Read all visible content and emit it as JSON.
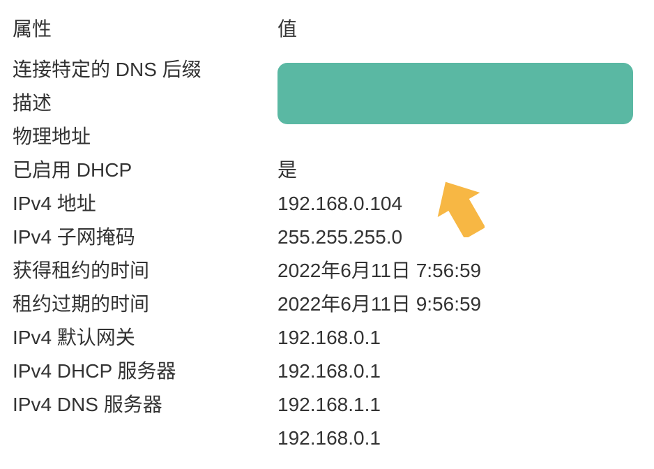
{
  "headers": {
    "property": "属性",
    "value": "值"
  },
  "rows": [
    {
      "label": "连接特定的 DNS 后缀",
      "value": ""
    },
    {
      "label": "描述",
      "value": ""
    },
    {
      "label": "物理地址",
      "value": ""
    },
    {
      "label": "已启用 DHCP",
      "value": "是"
    },
    {
      "label": "IPv4 地址",
      "value": "192.168.0.104"
    },
    {
      "label": "IPv4 子网掩码",
      "value": "255.255.255.0"
    },
    {
      "label": "获得租约的时间",
      "value": "2022年6月11日 7:56:59"
    },
    {
      "label": "租约过期的时间",
      "value": "2022年6月11日 9:56:59"
    },
    {
      "label": "IPv4 默认网关",
      "value": "192.168.0.1"
    },
    {
      "label": "IPv4 DHCP 服务器",
      "value": "192.168.0.1"
    },
    {
      "label": "IPv4 DNS 服务器",
      "value": "192.168.1.1"
    },
    {
      "label": "",
      "value": "192.168.0.1"
    }
  ],
  "annotation": {
    "arrow_color": "#f7b744"
  }
}
